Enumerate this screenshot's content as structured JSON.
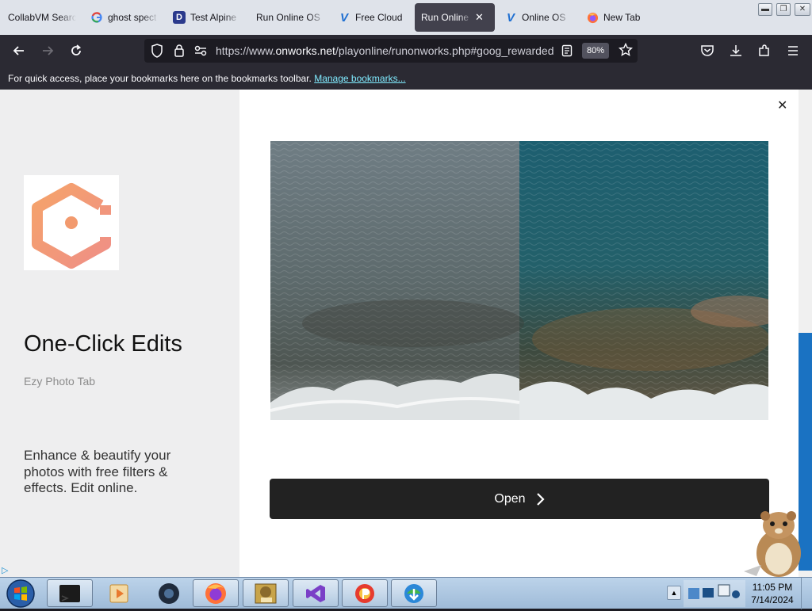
{
  "tabs": [
    {
      "label": "CollabVM Searc",
      "icon": "none",
      "active": false
    },
    {
      "label": "ghost spect",
      "icon": "google-icon",
      "active": false
    },
    {
      "label": "Test Alpine",
      "icon": "d-icon",
      "active": false
    },
    {
      "label": "Run Online OS",
      "icon": "none",
      "active": false
    },
    {
      "label": "Free Cloud",
      "icon": "v-icon",
      "active": false
    },
    {
      "label": "Run Online O",
      "icon": "none",
      "active": true
    },
    {
      "label": "Online OS",
      "icon": "v-icon",
      "active": false
    },
    {
      "label": "New Tab",
      "icon": "firefox-icon",
      "active": false
    }
  ],
  "nav": {
    "url_prefix": "https://www.",
    "url_domain": "onworks.net",
    "url_path": "/playonline/runonworks.php#goog_rewarded",
    "zoom": "80%"
  },
  "bookmarks_bar": {
    "message": "For quick access, place your bookmarks here on the bookmarks toolbar.",
    "link": "Manage bookmarks..."
  },
  "ad": {
    "title": "One-Click Edits",
    "subtitle": "Ezy Photo Tab",
    "description": "Enhance & beautify your photos with free filters & effects. Edit online.",
    "button_label": "Open",
    "close": "✕",
    "brand_color": "#f08a5d"
  },
  "taskbar": {
    "time": "11:05 PM",
    "date": "7/14/2024",
    "apps": [
      "terminal-app",
      "media-player-app",
      "gear-app",
      "firefox-app",
      "box-app",
      "visual-studio-app",
      "paint-app",
      "download-manager-app"
    ]
  }
}
